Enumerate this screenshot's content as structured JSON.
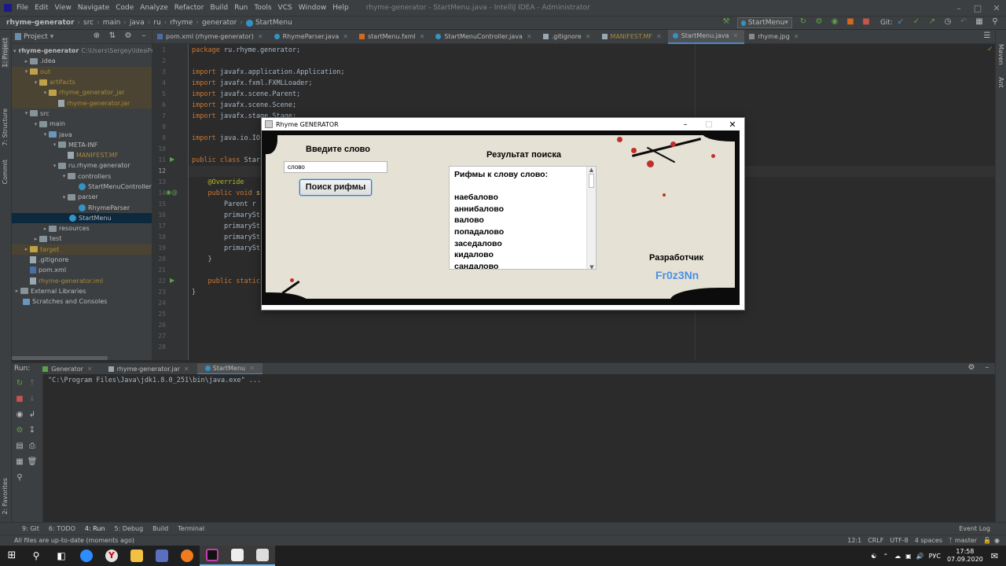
{
  "menubar": {
    "items": [
      "File",
      "Edit",
      "View",
      "Navigate",
      "Code",
      "Analyze",
      "Refactor",
      "Build",
      "Run",
      "Tools",
      "VCS",
      "Window",
      "Help"
    ],
    "title": "rhyme-generator - StartMenu.java - IntelliJ IDEA - Administrator"
  },
  "navbar": {
    "crumbs": [
      "rhyme-generator",
      "src",
      "main",
      "java",
      "ru",
      "rhyme",
      "generator",
      "StartMenu"
    ],
    "run_config": "StartMenu",
    "git_label": "Git:"
  },
  "left_stripe": {
    "project": "1: Project",
    "structure": "7: Structure",
    "commit": "Commit",
    "favorites": "2: Favorites"
  },
  "right_stripe": {
    "maven": "Maven",
    "ant": "Ant"
  },
  "project_panel": {
    "header": "Project",
    "rows": [
      {
        "label": "rhyme-generator",
        "extra": "C:\\Users\\Sergey\\IdeaPro"
      },
      {
        "label": ".idea"
      },
      {
        "label": "out"
      },
      {
        "label": "artifacts"
      },
      {
        "label": "rhyme_generator_jar"
      },
      {
        "label": "rhyme-generator.jar"
      },
      {
        "label": "src"
      },
      {
        "label": "main"
      },
      {
        "label": "java"
      },
      {
        "label": "META-INF"
      },
      {
        "label": "MANIFEST.MF"
      },
      {
        "label": "ru.rhyme.generator"
      },
      {
        "label": "controllers"
      },
      {
        "label": "StartMenuController"
      },
      {
        "label": "parser"
      },
      {
        "label": "RhymeParser"
      },
      {
        "label": "StartMenu"
      },
      {
        "label": "resources"
      },
      {
        "label": "test"
      },
      {
        "label": "target"
      },
      {
        "label": ".gitignore"
      },
      {
        "label": "pom.xml"
      },
      {
        "label": "rhyme-generator.iml"
      },
      {
        "label": "External Libraries"
      },
      {
        "label": "Scratches and Consoles"
      }
    ]
  },
  "editor_tabs": [
    "pom.xml (rhyme-generator)",
    "RhymeParser.java",
    "startMenu.fxml",
    "StartMenuController.java",
    ".gitignore",
    "MANIFEST.MF",
    "StartMenu.java",
    "rhyme.jpg"
  ],
  "editor": {
    "line_numbers": [
      "1",
      "2",
      "3",
      "4",
      "5",
      "6",
      "7",
      "8",
      "9",
      "10",
      "11",
      "12",
      "13",
      "14",
      "15",
      "16",
      "17",
      "18",
      "19",
      "20",
      "21",
      "22",
      "23",
      "24",
      "25",
      "26",
      "27",
      "28"
    ],
    "lines": {
      "l1a": "package",
      "l1b": " ru.rhyme.generator;",
      "l3a": "import",
      "l3b": " javafx.application.Application;",
      "l4a": "import",
      "l4b": " javafx.fxml.FXMLLoader;",
      "l5a": "import",
      "l5b": " javafx.scene.Parent;",
      "l6a": "import",
      "l6b": " javafx.scene.Scene;",
      "l7a": "import",
      "l7b": " javafx.stage.Stage;",
      "l9a": "import",
      "l9b": " java.io.IO",
      "l11a": "public class",
      "l11b": " Star",
      "l13": "@Override",
      "l14a": "public void",
      "l14b": " s",
      "l15": "Parent r",
      "l16": "primarySt",
      "l17": "primarySt",
      "l18": "primarySt",
      "l19": "primarySt",
      "l20": "}",
      "l22a": "public static",
      "l23": "}"
    }
  },
  "run_panel": {
    "label": "Run:",
    "tabs": [
      "Generator",
      "rhyme-generator.jar",
      "StartMenu"
    ],
    "output": "\"C:\\Program Files\\Java\\jdk1.8.0_251\\bin\\java.exe\" ..."
  },
  "bottom_tools": [
    "9: Git",
    "6: TODO",
    "4: Run",
    "5: Debug",
    "Build",
    "Terminal"
  ],
  "bottom_right": "Event Log",
  "status": {
    "message": "All files are up-to-date (moments ago)",
    "position": "12:1",
    "line_sep": "CRLF",
    "encoding": "UTF-8",
    "indent": "4 spaces",
    "branch": "master"
  },
  "taskbar": {
    "lang": "РУС",
    "time": "17:58",
    "date": "07.09.2020"
  },
  "app_window": {
    "title": "Rhyme GENERATOR",
    "enter_word_label": "Введите слово",
    "word_input_value": "слово",
    "search_button": "Поиск рифмы",
    "result_label": "Результат поиска",
    "result_lines": [
      "Рифмы к слову слово:",
      "",
      "наебалово",
      "аннибалово",
      "валово",
      "попадалово",
      "заседалово",
      "кидалово",
      "сандалово"
    ],
    "developer_label": "Разработчик",
    "developer_name": "Fr0z3Nn",
    "developer_color": "#4a90e2"
  }
}
